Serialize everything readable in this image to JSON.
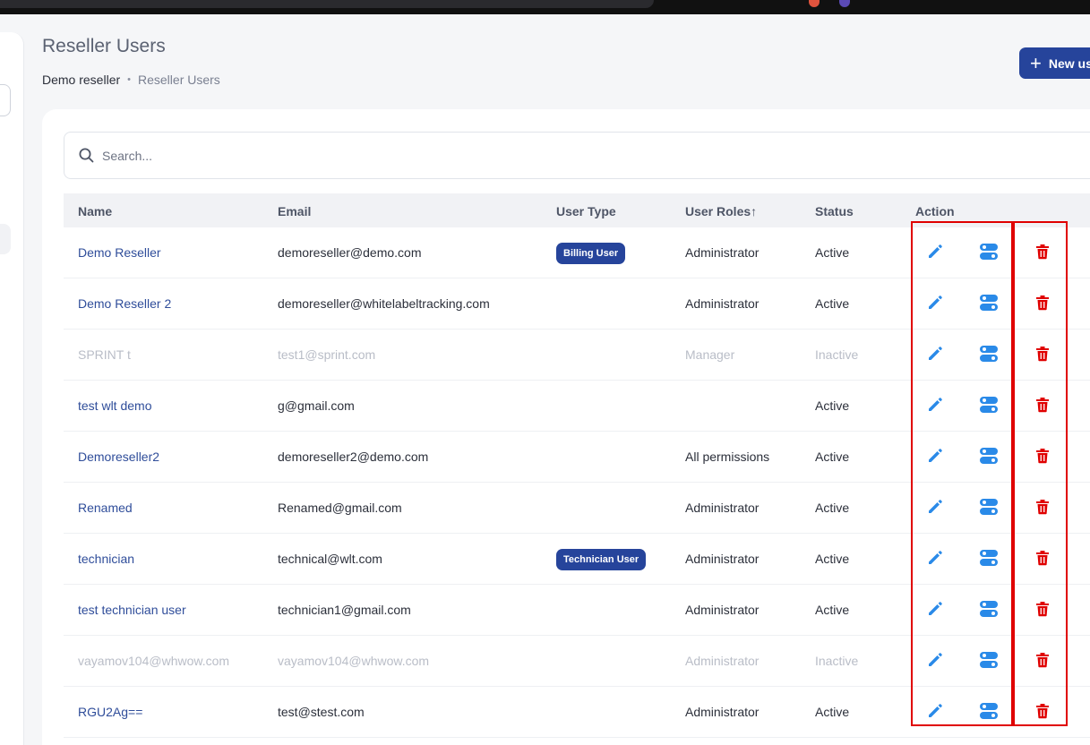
{
  "page": {
    "title": "Reseller Users",
    "breadcrumb": [
      "Demo reseller",
      "Reseller Users"
    ],
    "new_button_label": "New us"
  },
  "search": {
    "placeholder": "Search..."
  },
  "table": {
    "columns": [
      "Name",
      "Email",
      "User Type",
      "User Roles",
      "Status",
      "Action"
    ],
    "sort_icon": "arrow-up-icon",
    "rows": [
      {
        "name": "Demo Reseller",
        "email": "demoreseller@demo.com",
        "user_type": "Billing User",
        "role": "Administrator",
        "status": "Active"
      },
      {
        "name": "Demo Reseller 2",
        "email": "demoreseller@whitelabeltracking.com",
        "user_type": "",
        "role": "Administrator",
        "status": "Active"
      },
      {
        "name": "SPRINT t",
        "email": "test1@sprint.com",
        "user_type": "",
        "role": "Manager",
        "status": "Inactive"
      },
      {
        "name": "test wlt demo",
        "email": "g@gmail.com",
        "user_type": "",
        "role": "",
        "status": "Active"
      },
      {
        "name": "Demoreseller2",
        "email": "demoreseller2@demo.com",
        "user_type": "",
        "role": "All permissions",
        "status": "Active"
      },
      {
        "name": "Renamed",
        "email": "Renamed@gmail.com",
        "user_type": "",
        "role": "Administrator",
        "status": "Active"
      },
      {
        "name": "technician",
        "email": "technical@wlt.com",
        "user_type": "Technician User",
        "role": "Administrator",
        "status": "Active"
      },
      {
        "name": "test technician user",
        "email": "technician1@gmail.com",
        "user_type": "",
        "role": "Administrator",
        "status": "Active"
      },
      {
        "name": "vayamov104@whwow.com",
        "email": "vayamov104@whwow.com",
        "user_type": "",
        "role": "Administrator",
        "status": "Inactive"
      },
      {
        "name": "RGU2Ag==",
        "email": "test@stest.com",
        "user_type": "",
        "role": "Administrator",
        "status": "Active"
      }
    ],
    "actions": [
      "pencil-icon",
      "toggle-switches-icon",
      "trash-icon"
    ]
  },
  "colors": {
    "primary": "#26449b",
    "link": "#2f4d9a",
    "action_blue": "#2a8ae8",
    "delete_red": "#e00000",
    "inactive_text": "#b9bdc7",
    "highlight": "#e00000"
  }
}
